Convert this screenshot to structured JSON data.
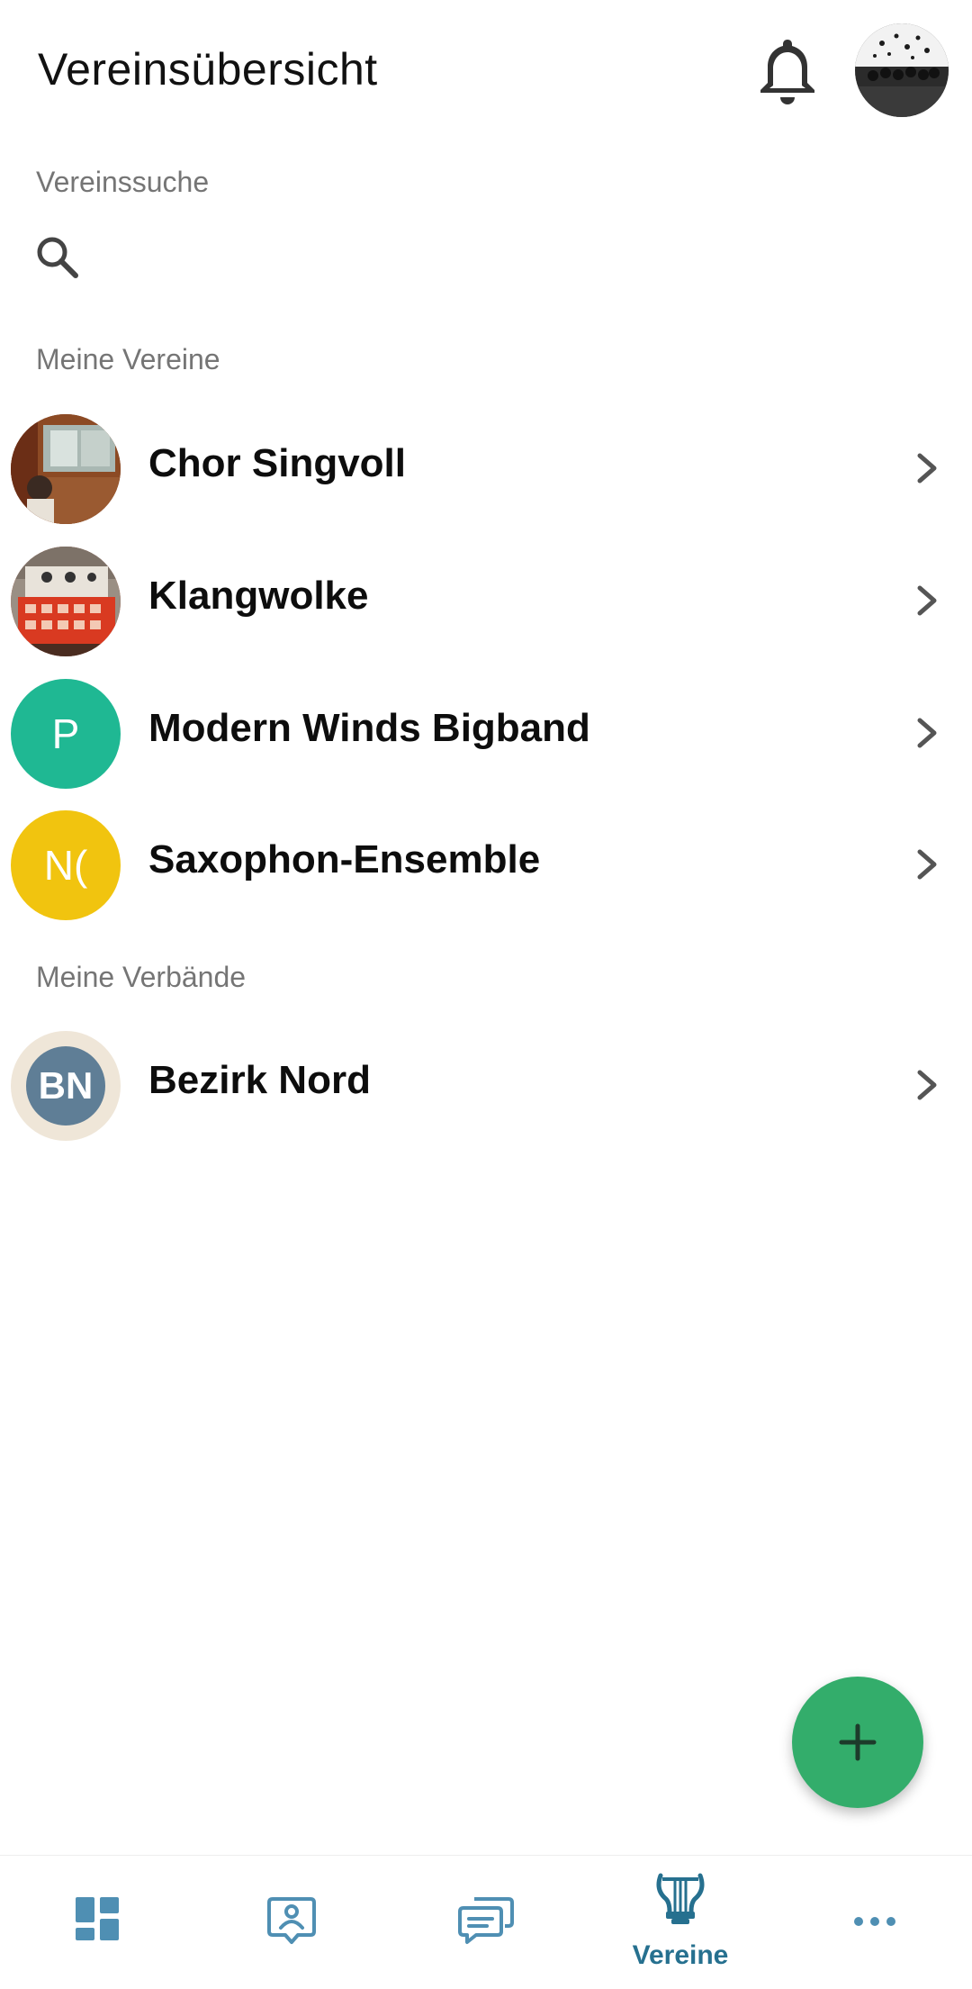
{
  "header": {
    "title": "Vereinsübersicht",
    "bell_icon": "bell-icon",
    "profile_icon": "profile-avatar"
  },
  "search": {
    "section_label": "Vereinssuche",
    "placeholder": "",
    "value": ""
  },
  "clubs": {
    "section_label": "Meine Vereine",
    "items": [
      {
        "name": "Chor Singvoll",
        "avatar_type": "photo"
      },
      {
        "name": "Klangwolke",
        "avatar_type": "photo"
      },
      {
        "name": "Modern Winds Bigband",
        "avatar_type": "initials",
        "initials": "P",
        "color": "#1fb893"
      },
      {
        "name": "Saxophon-Ensemble",
        "avatar_type": "initials",
        "initials": "N(",
        "color": "#f1c40f"
      }
    ]
  },
  "associations": {
    "section_label": "Meine Verbände",
    "items": [
      {
        "name": "Bezirk Nord",
        "avatar_type": "badge",
        "initials": "BN",
        "color": "#5f7e96",
        "ring_color": "#efe6d8"
      }
    ]
  },
  "fab": {
    "icon": "plus-icon",
    "color": "#33ad6b"
  },
  "bottom_nav": {
    "active_index": 3,
    "items": [
      {
        "icon": "dashboard-icon",
        "label": ""
      },
      {
        "icon": "member-icon",
        "label": ""
      },
      {
        "icon": "chat-icon",
        "label": ""
      },
      {
        "icon": "lyre-icon",
        "label": "Vereine"
      },
      {
        "icon": "more-icon",
        "label": ""
      }
    ],
    "color": "#26708f"
  }
}
